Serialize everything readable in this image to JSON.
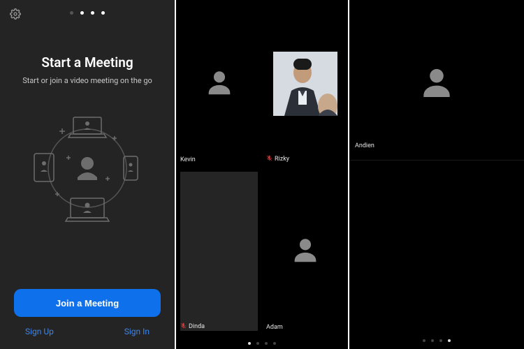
{
  "left": {
    "title": "Start a Meeting",
    "subtitle": "Start or join a video meeting on the go",
    "join_label": "Join a Meeting",
    "signup_label": "Sign Up",
    "signin_label": "Sign In",
    "page_dots": {
      "count": 4,
      "active": 1
    }
  },
  "mid": {
    "tiles": [
      {
        "name": "Kevin",
        "muted": false,
        "has_photo": false,
        "dark": false
      },
      {
        "name": "Rizky",
        "muted": true,
        "has_photo": true,
        "dark": false
      },
      {
        "name": "Dinda",
        "muted": true,
        "has_photo": false,
        "dark": true
      },
      {
        "name": "Adam",
        "muted": false,
        "has_photo": false,
        "dark": false
      }
    ],
    "page_dots": {
      "count": 4,
      "active": 0
    }
  },
  "right": {
    "name": "Andien",
    "page_dots": {
      "count": 4,
      "active": 3
    }
  },
  "colors": {
    "primary": "#0e71eb",
    "link": "#3b86f0"
  }
}
